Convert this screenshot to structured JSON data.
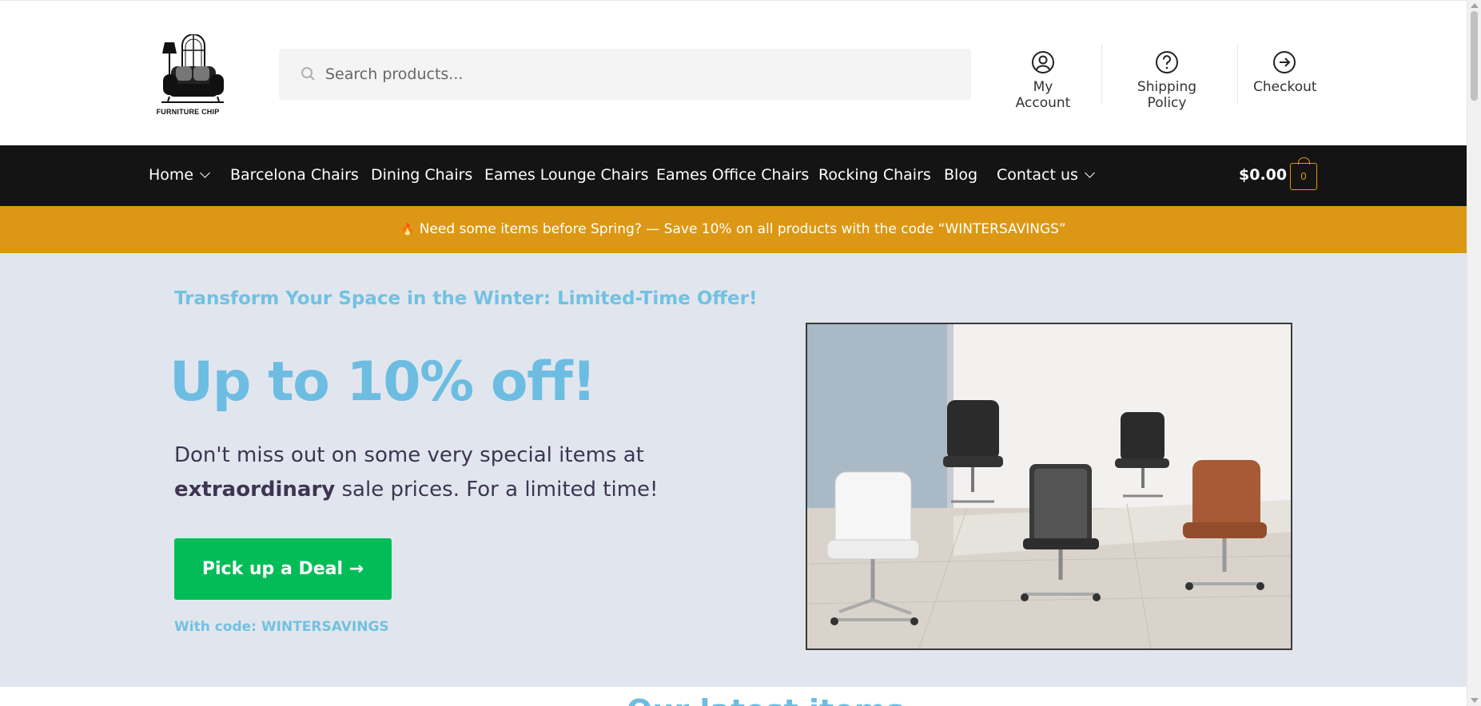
{
  "brand": {
    "logo_text": "FURNITURE CHIP",
    "logo_icon": "sofa-lamp-logo"
  },
  "search": {
    "placeholder": "Search products...",
    "icon": "search-icon"
  },
  "header_links": [
    {
      "label": "My Account",
      "icon": "user-circle-icon"
    },
    {
      "label": "Shipping Policy",
      "icon": "question-circle-icon"
    },
    {
      "label": "Checkout",
      "icon": "arrow-circle-icon"
    }
  ],
  "nav": {
    "items": [
      {
        "label": "Home",
        "has_dropdown": true
      },
      {
        "label": "Barcelona Chairs"
      },
      {
        "label": "Dining Chairs"
      },
      {
        "label": "Eames Lounge Chairs"
      },
      {
        "label": "Eames Office Chairs"
      },
      {
        "label": "Rocking Chairs"
      },
      {
        "label": "Blog"
      },
      {
        "label": "Contact us",
        "has_dropdown": true
      }
    ],
    "cart_total": "$0.00",
    "cart_count": "0"
  },
  "promo": {
    "icon": "fire-emoji",
    "text": "Need some items before Spring? — Save 10% on all products with the code “WINTERSAVINGS”"
  },
  "hero": {
    "eyebrow": "Transform Your Space in the Winter: Limited-Time Offer!",
    "headline": "Up to 10% off!",
    "subcopy_pre": "Don't miss out on some very special items at",
    "subcopy_bold": "extraordinary",
    "subcopy_post": "sale prices. For a limited time!",
    "cta_label": "Pick up a Deal →",
    "code_line": "With code: WINTERSAVINGS",
    "image_alt": "office-chairs-photo"
  },
  "next_section_peek": "Our latest items",
  "colors": {
    "nav_bg": "#141414",
    "promo_bg": "#dc9814",
    "hero_bg": "#e1e6ee",
    "accent_blue": "#6cbde1",
    "cta_green": "#02bd57",
    "text_dark": "#3d3551"
  }
}
